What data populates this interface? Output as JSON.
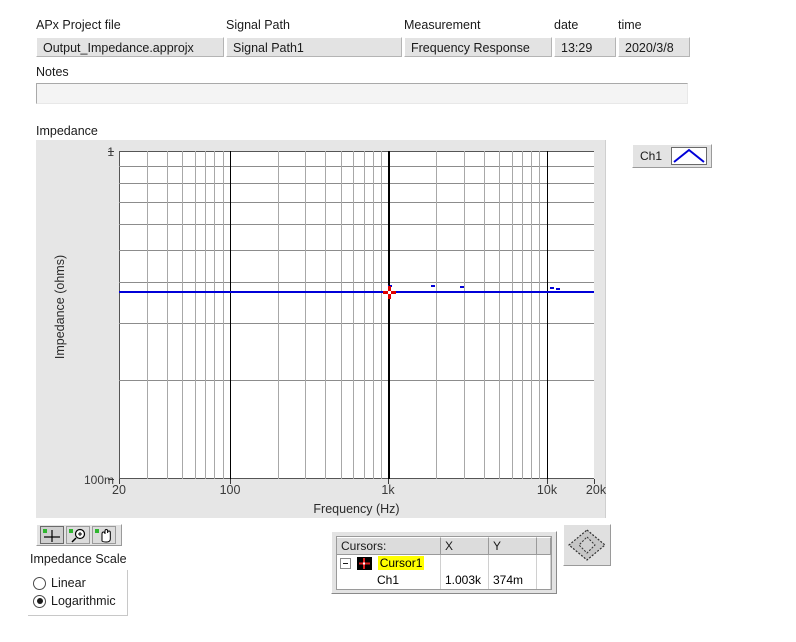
{
  "header": {
    "fields": [
      {
        "label": "APx Project file",
        "value": "Output_Impedance.approjx"
      },
      {
        "label": "Signal Path",
        "value": "Signal Path1"
      },
      {
        "label": "Measurement",
        "value": "Frequency Response"
      },
      {
        "label": "date",
        "value": "13:29"
      },
      {
        "label": "time",
        "value": "2020/3/8"
      }
    ],
    "notes_label": "Notes",
    "notes_value": "",
    "notes_placeholder": ""
  },
  "graph": {
    "title": "Impedance",
    "legend": {
      "channel_label": "Ch1",
      "swatch_icon": "peak-line-icon",
      "color": "#0000d8"
    },
    "toolbar": [
      {
        "name": "cursor-tool",
        "icon": "crosshair-icon",
        "active": true
      },
      {
        "name": "zoom-tool",
        "icon": "magnifier-zoom-icon",
        "active": false
      },
      {
        "name": "pan-tool",
        "icon": "hand-pan-icon",
        "active": false
      }
    ]
  },
  "chart_data": {
    "type": "line",
    "title": "Impedance",
    "xlabel": "Frequency (Hz)",
    "ylabel": "Impedance (ohms)",
    "xscale": "log",
    "yscale": "log",
    "xlim": [
      20,
      20000
    ],
    "ylim": [
      0.1,
      1.0
    ],
    "grid": true,
    "x_tick_labels": [
      "20",
      "100",
      "1k",
      "10k",
      "20k"
    ],
    "x_tick_values": [
      20,
      100,
      1000,
      10000,
      20000
    ],
    "y_tick_labels": [
      "1",
      "100m"
    ],
    "y_tick_values": [
      1.0,
      0.1
    ],
    "legend_position": "outside-top-right",
    "series": [
      {
        "name": "Ch1",
        "color": "#0000d8",
        "x": [
          20,
          30,
          50,
          80,
          100,
          200,
          400,
          700,
          1000,
          1003,
          2000,
          4000,
          7000,
          10000,
          14000,
          20000
        ],
        "values": [
          0.374,
          0.374,
          0.374,
          0.374,
          0.374,
          0.374,
          0.374,
          0.374,
          0.374,
          0.374,
          0.374,
          0.374,
          0.374,
          0.374,
          0.374,
          0.374
        ]
      }
    ],
    "annotations": [
      {
        "type": "cursor",
        "name": "Cursor1",
        "x": 1003,
        "y": 0.374,
        "marker": "red-cross-marker"
      }
    ]
  },
  "cursors": {
    "columns": [
      "Cursors:",
      "X",
      "Y"
    ],
    "rows": [
      {
        "name": "Cursor1",
        "x": "",
        "y": "",
        "highlight": true,
        "expander": "collapse"
      },
      {
        "name": "Ch1",
        "x": "1.003k",
        "y": "374m",
        "highlight": false
      }
    ]
  },
  "scale": {
    "label": "Impedance Scale",
    "options": [
      {
        "label": "Linear",
        "selected": false
      },
      {
        "label": "Logarithmic",
        "selected": true
      }
    ]
  }
}
